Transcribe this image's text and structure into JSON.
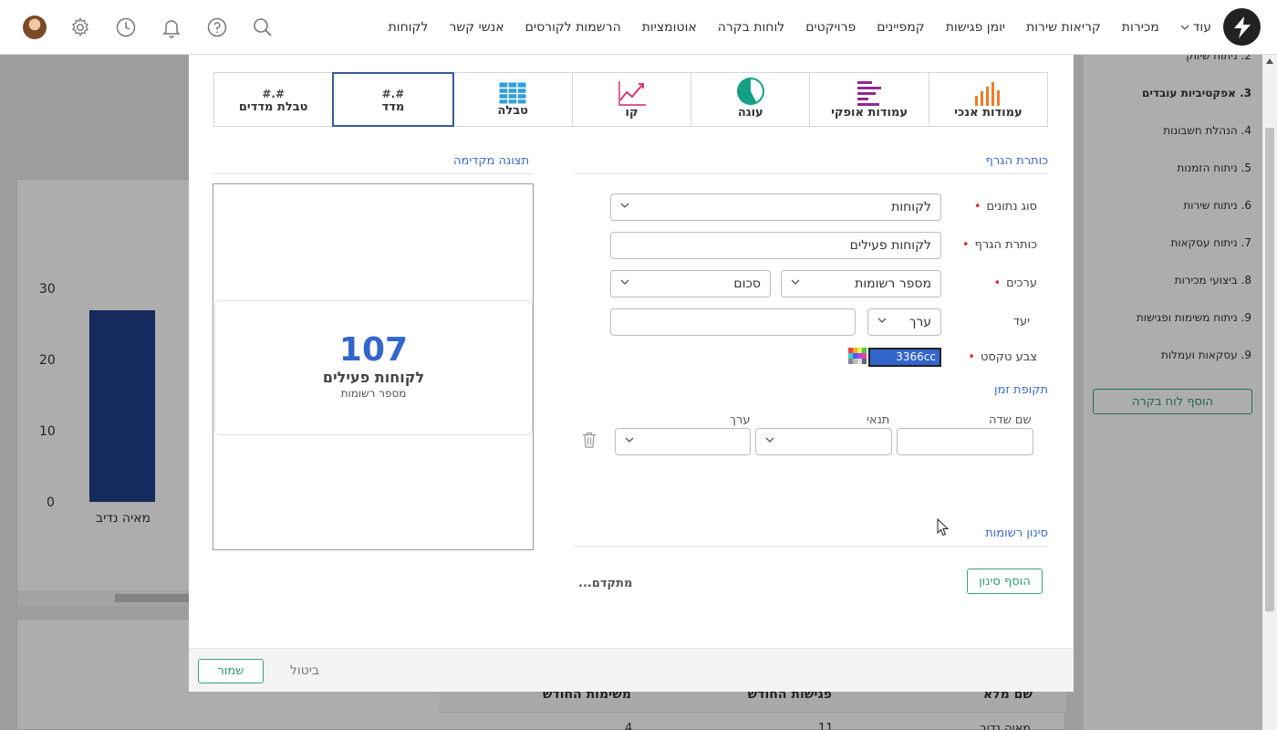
{
  "nav": {
    "items": [
      "לקוחות",
      "אנשי קשר",
      "הרשמות לקורסים",
      "אוטומציות",
      "לוחות בקרה",
      "פרויקטים",
      "קמפיינים",
      "יומן פגישות",
      "קריאות שירות",
      "מכירות"
    ],
    "more": "עוד",
    "icons": [
      "search-icon",
      "help-icon",
      "bell-icon",
      "clock-icon",
      "gear-icon"
    ]
  },
  "background": {
    "chart": {
      "ticks": [
        "30",
        "20",
        "10",
        "0"
      ],
      "bar_label": "מאיה נדיב"
    },
    "side_menu": {
      "items": [
        {
          "text": "2. ניתוח שיווק",
          "bold": false
        },
        {
          "text": "3. אפקטיביות עובדים",
          "bold": true
        },
        {
          "text": "4. הנהלת חשבונות",
          "bold": false
        },
        {
          "text": "5. ניתוח הזמנות",
          "bold": false
        },
        {
          "text": "6. ניתוח שירות",
          "bold": false
        },
        {
          "text": "7. ניתוח עסקאות",
          "bold": false
        },
        {
          "text": "8. ביצועי מכירות",
          "bold": false
        },
        {
          "text": "9. ניתוח משימות ופגישות",
          "bold": false
        },
        {
          "text": "9. עסקאות ועמלות",
          "bold": false
        }
      ],
      "add_button": "הוסף לוח בקרה"
    },
    "table": {
      "headers": [
        "שם מלא",
        "פגישות החודש",
        "משימות החודש"
      ],
      "row": [
        "מאיה נדיב",
        "11",
        "4"
      ]
    }
  },
  "modal": {
    "chart_types": [
      {
        "id": "vertical-bars",
        "label": "עמודות אנכי",
        "icon": "bar-chart-icon",
        "color": "#f07b27"
      },
      {
        "id": "horizontal-bars",
        "label": "עמודות אופקי",
        "icon": "horizontal-bar-icon",
        "color": "#8e2a8f"
      },
      {
        "id": "pie",
        "label": "עוגה",
        "icon": "pie-chart-icon",
        "color": "#14a085"
      },
      {
        "id": "line",
        "label": "קו",
        "icon": "line-chart-icon",
        "color": "#d2266a"
      },
      {
        "id": "table",
        "label": "טבלה",
        "icon": "table-icon",
        "color": "#2e9fd8"
      },
      {
        "id": "metric",
        "label": "מדד",
        "hash": "#.#",
        "active": true
      },
      {
        "id": "metric-table",
        "label": "טבלת מדדים",
        "hash": "#.#"
      }
    ],
    "form": {
      "section_title": "כותרת הגרף",
      "data_type_label": "סוג נתונים",
      "data_type_value": "לקוחות",
      "chart_title_label": "כותרת הגרף",
      "chart_title_value": "לקוחות פעילים",
      "values_label": "ערכים",
      "values_field": "מספר רשומות",
      "values_agg": "סכום",
      "target_label": "יעד",
      "target_type": "ערך",
      "target_value": "",
      "text_color_label": "צבע טקסט",
      "text_color_value": "3366cc",
      "time_period_title": "תקופת זמן",
      "col_field_name": "שם שדה",
      "col_condition": "תנאי",
      "col_value": "ערך",
      "filter_title": "סינון רשומות",
      "add_filter": "הוסף סינון",
      "advanced": "מתקדם..."
    },
    "preview": {
      "title": "תצוגה מקדימה",
      "value": "107",
      "metric_title": "לקוחות פעילים",
      "metric_sub": "מספר רשומות"
    },
    "footer": {
      "save": "שמור",
      "cancel": "ביטול"
    }
  },
  "colors": {
    "accent": "#3366cc",
    "green": "#2e9a6c",
    "navy_bar": "#1f3f8a"
  }
}
